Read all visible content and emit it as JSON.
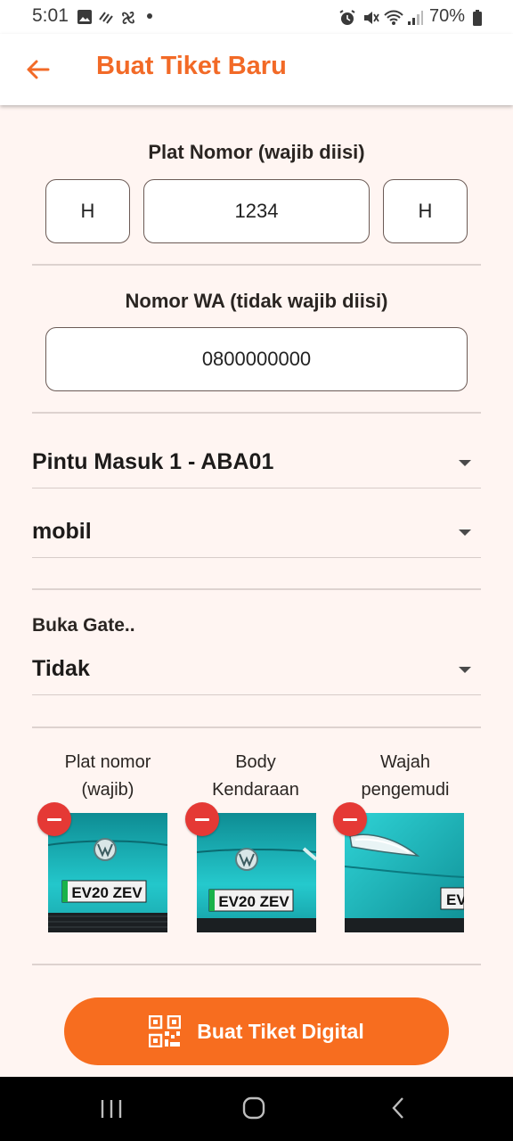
{
  "status_bar": {
    "time": "5:01",
    "battery": "70%"
  },
  "app_bar": {
    "title": "Buat Tiket Baru"
  },
  "plate": {
    "label": "Plat Nomor (wajib diisi)",
    "prefix": "H",
    "number": "1234",
    "suffix": "H"
  },
  "whatsapp": {
    "label": "Nomor WA (tidak wajib diisi)",
    "value": "0800000000"
  },
  "gate_select": {
    "value": "Pintu Masuk 1 - ABA01"
  },
  "vehicle_select": {
    "value": "mobil"
  },
  "open_gate": {
    "label": "Buka Gate..",
    "value": "Tidak"
  },
  "photos": [
    {
      "line1": "Plat nomor",
      "line2": "(wajib)",
      "plate_text": "EV20 ZEV"
    },
    {
      "line1": "Body",
      "line2": "Kendaraan",
      "plate_text": "EV20 ZEV"
    },
    {
      "line1": "Wajah",
      "line2": "pengemudi",
      "plate_text": "EV"
    }
  ],
  "submit": {
    "label": "Buat Tiket Digital"
  },
  "colors": {
    "accent": "#f26a27",
    "button": "#f76d1f",
    "remove": "#e53935",
    "background": "#fff5f2"
  }
}
